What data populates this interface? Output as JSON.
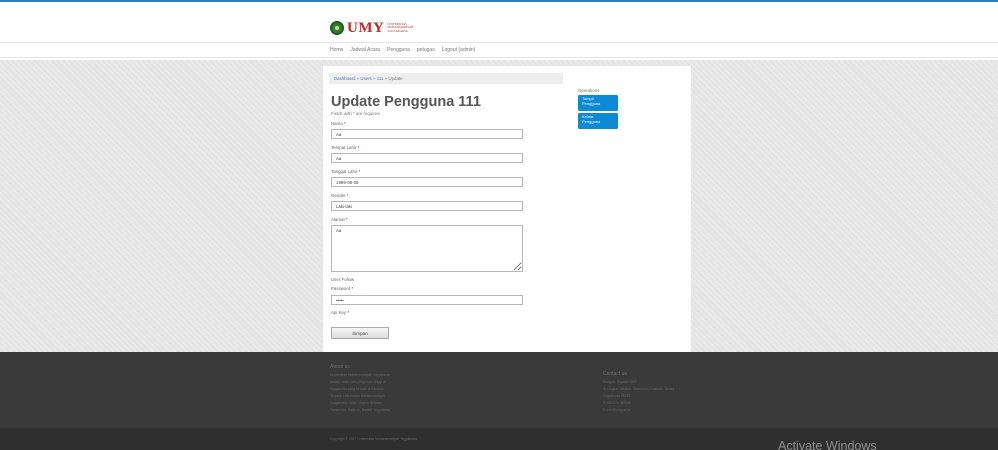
{
  "brand": {
    "name": "UMY",
    "sub_lines": [
      "UNIVERSITAS",
      "MUHAMMADIYAH",
      "YOGYAKARTA"
    ]
  },
  "nav": {
    "items": [
      "Home",
      "Jadwal Acara",
      "Pengguna",
      "petugas",
      "Logout (admin)"
    ]
  },
  "breadcrumb": {
    "items": [
      "Dashboard",
      "Users",
      "111"
    ],
    "separator": "»",
    "current": "Update"
  },
  "page": {
    "title": "Update Pengguna 111",
    "required_note": "Fields with * are required."
  },
  "form": {
    "nama": {
      "label": "Nama",
      "value": "Aa"
    },
    "tempat_lahir": {
      "label": "Tempat Lahir",
      "value": "Aa"
    },
    "tanggal_lahir": {
      "label": "Tanggal Lahir",
      "value": "1999-08-08"
    },
    "gender": {
      "label": "Gender",
      "value": "Laki-laki"
    },
    "alamat": {
      "label": "Alamat",
      "value": "Aa"
    },
    "user_follow": {
      "label": "User Follow"
    },
    "password": {
      "label": "Password",
      "value": "•••••"
    },
    "api_key": {
      "label": "Api Key"
    },
    "required_mark": "*",
    "submit_label": "Simpan"
  },
  "operations": {
    "title": "Operations",
    "items": [
      {
        "line1": "Tampil",
        "line2": "Pengguna"
      },
      {
        "line1": "Kelola",
        "line2": "Pengguna"
      }
    ]
  },
  "footer": {
    "about_title": "About us",
    "about_lines": [
      "Universitas Muhammadiyah Yogyakarta",
      "adalah salah satu perguruan tinggi di",
      "Yogyakarta yang berada di Kampus",
      "Terpadu Universitas Muhammadiyah",
      "Yogyakarta, Jalan Lingkar Selatan,",
      "Tamantirto, Kasihan, Bantul, Yogyakarta"
    ],
    "contact_title": "Contact us",
    "contact_lines": [
      "Kampus Terpadu UMY",
      "Jl. Lingkar Selatan, Tamantirto, Kasihan, Bantul",
      "Yogyakarta 55183",
      "T. +62 274 387656",
      "E. info@umy.ac.id"
    ],
    "copyright": "Copyright © 2017 Universitas Muhammadiyah Yogyakarta"
  },
  "overlay": {
    "watermark": "Activate Windows"
  }
}
